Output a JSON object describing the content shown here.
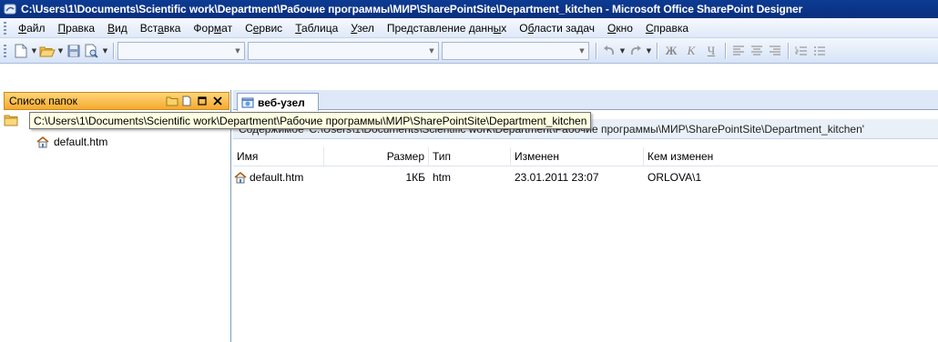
{
  "window": {
    "title": "C:\\Users\\1\\Documents\\Scientific work\\Department\\Рабочие программы\\МИР\\SharePointSite\\Department_kitchen - Microsoft Office SharePoint Designer"
  },
  "menubar": {
    "items": [
      {
        "pre": "",
        "ul": "Ф",
        "post": "айл"
      },
      {
        "pre": "",
        "ul": "П",
        "post": "равка"
      },
      {
        "pre": "",
        "ul": "В",
        "post": "ид"
      },
      {
        "pre": "Вст",
        "ul": "а",
        "post": "вка"
      },
      {
        "pre": "Фор",
        "ul": "м",
        "post": "ат"
      },
      {
        "pre": "С",
        "ul": "е",
        "post": "рвис"
      },
      {
        "pre": "",
        "ul": "Т",
        "post": "аблица"
      },
      {
        "pre": "",
        "ul": "У",
        "post": "зел"
      },
      {
        "pre": "Представление данн",
        "ul": "ы",
        "post": "х"
      },
      {
        "pre": "О",
        "ul": "б",
        "post": "ласти задач"
      },
      {
        "pre": "",
        "ul": "О",
        "post": "кно"
      },
      {
        "pre": "",
        "ul": "С",
        "post": "правка"
      }
    ]
  },
  "toolbar": {
    "bold": "Ж",
    "italic": "К",
    "underline": "Ч"
  },
  "folder_pane": {
    "title": "Список папок",
    "items": [
      {
        "label": "default.htm"
      }
    ]
  },
  "tooltip": {
    "text": "C:\\Users\\1\\Documents\\Scientific work\\Department\\Рабочие программы\\МИР\\SharePointSite\\Department_kitchen"
  },
  "tabs": [
    {
      "label": "веб-узел"
    }
  ],
  "pathbar": {
    "text": "Содержимое 'C:\\Users\\1\\Documents\\Scientific work\\Department\\Рабочие программы\\МИР\\SharePointSite\\Department_kitchen'"
  },
  "file_list": {
    "columns": [
      "Имя",
      "Размер",
      "Тип",
      "Изменен",
      "Кем изменен"
    ],
    "rows": [
      {
        "name": "default.htm",
        "size": "1КБ",
        "type": "htm",
        "modified": "23.01.2011 23:07",
        "modified_by": "ORLOVA\\1"
      }
    ]
  },
  "colors": {
    "title_bar": "#0a2f7e",
    "pane_header": "#f6a930",
    "tooltip_bg": "#ffffe1"
  }
}
